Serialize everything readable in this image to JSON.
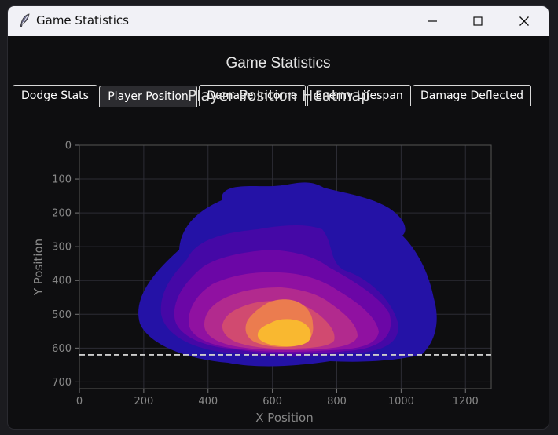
{
  "window": {
    "title": "Game Statistics"
  },
  "heading": "Game Statistics",
  "tabs": [
    {
      "label": "Dodge Stats",
      "active": false
    },
    {
      "label": "Player Position",
      "active": true
    },
    {
      "label": "Damage Income",
      "active": false
    },
    {
      "label": "Enemy Lifespan",
      "active": false
    },
    {
      "label": "Damage Deflected",
      "active": false
    }
  ],
  "colors": {
    "background": "#0e0e10",
    "titlebar": "#f1f1f6",
    "heat_low": "#2412a6",
    "heat_high": "#f9b830",
    "threshold_line": "#cccccc"
  },
  "chart_data": {
    "type": "heatmap",
    "title": "Player Position Heatmap",
    "xlabel": "X Position",
    "ylabel": "Y Position",
    "xlim": [
      0,
      1280
    ],
    "ylim": [
      720,
      0
    ],
    "x_ticks": [
      0,
      200,
      400,
      600,
      800,
      1000,
      1200
    ],
    "y_ticks": [
      0,
      100,
      200,
      300,
      400,
      500,
      600,
      700
    ],
    "grid": true,
    "hline_y": 620,
    "density_peak": {
      "x": 630,
      "y": 560
    },
    "colormap": "plasma"
  }
}
